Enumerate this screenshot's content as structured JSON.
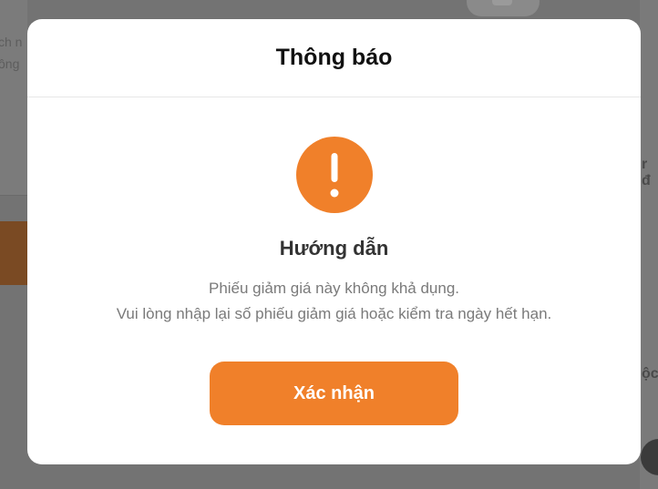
{
  "background": {
    "left_fragment_top": "ch n",
    "left_fragment_bottom": "ông",
    "right_fragment_top": "r đ",
    "right_fragment_bottom": "ộc"
  },
  "modal": {
    "title": "Thông báo",
    "icon": "exclamation-icon",
    "heading": "Hướng dẫn",
    "message_lines": [
      "Phiếu giảm giá này không khả dụng.",
      "Vui lòng nhập lại số phiếu giảm giá hoặc kiểm tra ngày hết hạn."
    ],
    "confirm_label": "Xác nhận"
  },
  "colors": {
    "accent": "#f0802a",
    "overlay": "#737373",
    "title_text": "#111111",
    "heading_text": "#333333",
    "message_text": "#7a7a7a"
  }
}
